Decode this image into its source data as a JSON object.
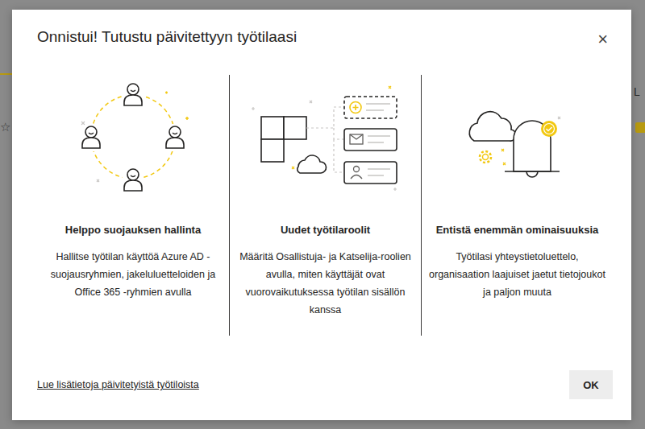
{
  "background": {
    "left_glyph": "☆",
    "right_text": "L"
  },
  "dialog": {
    "title": "Onnistui! Tutustu päivitettyyn työtilaasi",
    "close": "×"
  },
  "features": [
    {
      "kind": "people",
      "heading": "Helppo suojauksen hallinta",
      "description": "Hallitse työtilan käyttöä Azure AD -suojausryhmien, jakeluluetteloiden ja Office 365 -ryhmien avulla"
    },
    {
      "kind": "roles",
      "heading": "Uudet työtilaroolit",
      "description": "Määritä Osallistuja- ja Katselija-roolien avulla, miten käyttäjät ovat vuorovaikutuksessa työtilan sisällön kanssa"
    },
    {
      "kind": "features",
      "heading": "Entistä enemmän ominaisuuksia",
      "description": "Työtilasi yhteystietoluettelo, organisaation laajuiset jaetut tietojoukot ja paljon muuta"
    }
  ],
  "footer": {
    "link": "Lue lisätietoja päivitetyistä työtiloista",
    "buttons": [
      "OK"
    ]
  }
}
